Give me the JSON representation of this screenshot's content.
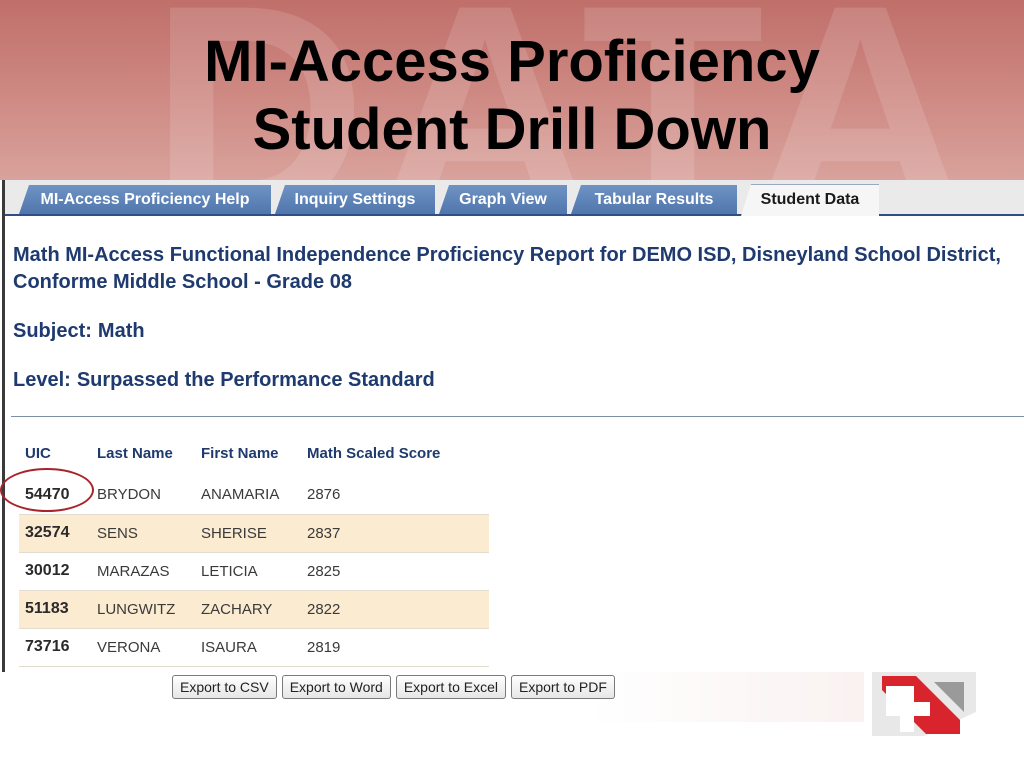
{
  "slide": {
    "title_line1": "MI-Access Proficiency",
    "title_line2": "Student Drill Down",
    "watermark_text": "DATA",
    "header_color": "#c06f6a"
  },
  "tabs": [
    {
      "label": "MI-Access Proficiency Help",
      "active": false
    },
    {
      "label": "Inquiry Settings",
      "active": false
    },
    {
      "label": "Graph View",
      "active": false
    },
    {
      "label": "Tabular Results",
      "active": false
    },
    {
      "label": "Student Data",
      "active": true
    }
  ],
  "report": {
    "title": "Math MI-Access Functional Independence Proficiency Report for DEMO ISD, Disneyland School District, Conforme Middle School - Grade 08",
    "subject_label": "Subject:",
    "subject_value": "Math",
    "level_label": "Level:",
    "level_value": "Surpassed the Performance Standard"
  },
  "table": {
    "headers": [
      "UIC",
      "Last Name",
      "First Name",
      "Math Scaled Score"
    ],
    "rows": [
      {
        "uic": "54470",
        "last": "BRYDON",
        "first": "ANAMARIA",
        "score": "2876"
      },
      {
        "uic": "32574",
        "last": "SENS",
        "first": "SHERISE",
        "score": "2837"
      },
      {
        "uic": "30012",
        "last": "MARAZAS",
        "first": "LETICIA",
        "score": "2825"
      },
      {
        "uic": "51183",
        "last": "LUNGWITZ",
        "first": "ZACHARY",
        "score": "2822"
      },
      {
        "uic": "73716",
        "last": "VERONA",
        "first": "ISAURA",
        "score": "2819"
      }
    ]
  },
  "export": {
    "csv": "Export to CSV",
    "word": "Export to Word",
    "excel": "Export to Excel",
    "pdf": "Export to PDF"
  },
  "colors": {
    "tab_blue": "#4f76ad",
    "report_text": "#1e3a6e",
    "row_band": "#fbebd1",
    "highlight": "#a8242b",
    "logo_red": "#d8242c"
  },
  "logo": {
    "icon": "data-for-success-logo"
  }
}
